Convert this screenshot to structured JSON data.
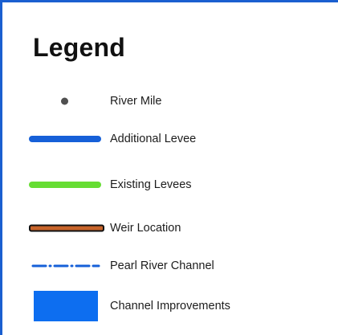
{
  "legend": {
    "title": "Legend",
    "items": [
      {
        "label": "River Mile",
        "symbol": "dot",
        "color": "#505050"
      },
      {
        "label": "Additional Levee",
        "symbol": "line",
        "color": "#1660d8"
      },
      {
        "label": "Existing Levees",
        "symbol": "line",
        "color": "#66dd33"
      },
      {
        "label": "Weir Location",
        "symbol": "outlined-line",
        "color": "#c8642a",
        "outline": "#111111"
      },
      {
        "label": "Pearl River Channel",
        "symbol": "dash-dot-line",
        "color": "#1660d8"
      },
      {
        "label": "Channel Improvements",
        "symbol": "filled-rectangle",
        "color": "#0d6ef0"
      }
    ]
  },
  "colors": {
    "frame_border": "#1a5fd0",
    "background": "#ffffff"
  }
}
